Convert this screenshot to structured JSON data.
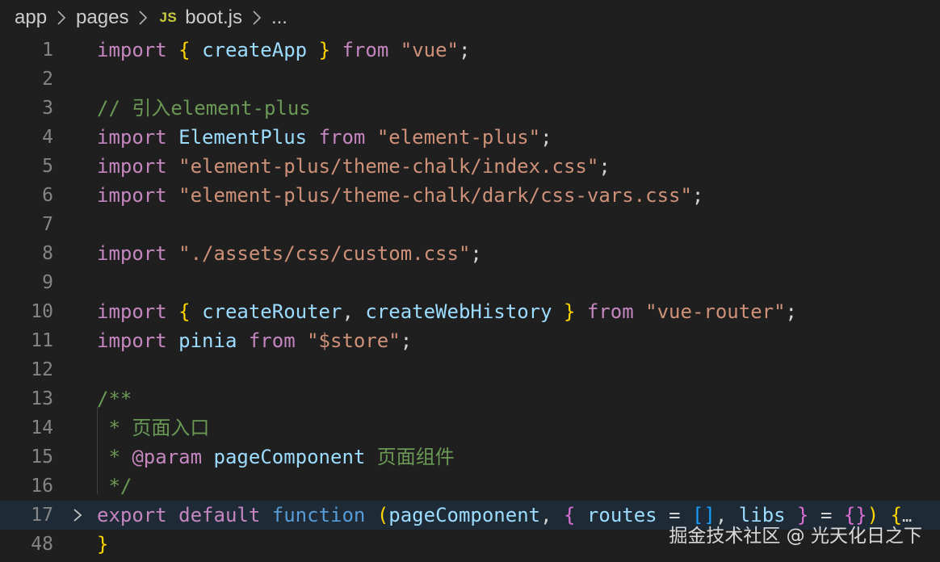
{
  "breadcrumb": {
    "items": [
      "app",
      "pages"
    ],
    "file_badge": "JS",
    "file_name": "boot.js",
    "overflow": "..."
  },
  "editor": {
    "lines": [
      {
        "num": "1",
        "tokens": [
          [
            "kw",
            "import"
          ],
          [
            "pun",
            " "
          ],
          [
            "br1",
            "{"
          ],
          [
            "pun",
            " "
          ],
          [
            "id",
            "createApp"
          ],
          [
            "pun",
            " "
          ],
          [
            "br1",
            "}"
          ],
          [
            "pun",
            " "
          ],
          [
            "kw",
            "from"
          ],
          [
            "pun",
            " "
          ],
          [
            "str",
            "\"vue\""
          ],
          [
            "pun",
            ";"
          ]
        ]
      },
      {
        "num": "2",
        "tokens": []
      },
      {
        "num": "3",
        "tokens": [
          [
            "com",
            "// 引入element-plus"
          ]
        ]
      },
      {
        "num": "4",
        "tokens": [
          [
            "kw",
            "import"
          ],
          [
            "pun",
            " "
          ],
          [
            "id",
            "ElementPlus"
          ],
          [
            "pun",
            " "
          ],
          [
            "kw",
            "from"
          ],
          [
            "pun",
            " "
          ],
          [
            "str",
            "\"element-plus\""
          ],
          [
            "pun",
            ";"
          ]
        ]
      },
      {
        "num": "5",
        "tokens": [
          [
            "kw",
            "import"
          ],
          [
            "pun",
            " "
          ],
          [
            "str",
            "\"element-plus/theme-chalk/index.css\""
          ],
          [
            "pun",
            ";"
          ]
        ]
      },
      {
        "num": "6",
        "tokens": [
          [
            "kw",
            "import"
          ],
          [
            "pun",
            " "
          ],
          [
            "str",
            "\"element-plus/theme-chalk/dark/css-vars.css\""
          ],
          [
            "pun",
            ";"
          ]
        ]
      },
      {
        "num": "7",
        "tokens": []
      },
      {
        "num": "8",
        "tokens": [
          [
            "kw",
            "import"
          ],
          [
            "pun",
            " "
          ],
          [
            "str",
            "\"./assets/css/custom.css\""
          ],
          [
            "pun",
            ";"
          ]
        ]
      },
      {
        "num": "9",
        "tokens": []
      },
      {
        "num": "10",
        "tokens": [
          [
            "kw",
            "import"
          ],
          [
            "pun",
            " "
          ],
          [
            "br1",
            "{"
          ],
          [
            "pun",
            " "
          ],
          [
            "id",
            "createRouter"
          ],
          [
            "pun",
            ", "
          ],
          [
            "id",
            "createWebHistory"
          ],
          [
            "pun",
            " "
          ],
          [
            "br1",
            "}"
          ],
          [
            "pun",
            " "
          ],
          [
            "kw",
            "from"
          ],
          [
            "pun",
            " "
          ],
          [
            "str",
            "\"vue-router\""
          ],
          [
            "pun",
            ";"
          ]
        ]
      },
      {
        "num": "11",
        "tokens": [
          [
            "kw",
            "import"
          ],
          [
            "pun",
            " "
          ],
          [
            "id",
            "pinia"
          ],
          [
            "pun",
            " "
          ],
          [
            "kw",
            "from"
          ],
          [
            "pun",
            " "
          ],
          [
            "str",
            "\"$store\""
          ],
          [
            "pun",
            ";"
          ]
        ]
      },
      {
        "num": "12",
        "tokens": []
      },
      {
        "num": "13",
        "tokens": [
          [
            "com",
            "/**"
          ]
        ]
      },
      {
        "num": "14",
        "tokens": [
          [
            "com",
            " * 页面入口"
          ]
        ]
      },
      {
        "num": "15",
        "tokens": [
          [
            "com",
            " * "
          ],
          [
            "tag",
            "@param"
          ],
          [
            "pun",
            " "
          ],
          [
            "id",
            "pageComponent"
          ],
          [
            "com",
            " 页面组件"
          ]
        ]
      },
      {
        "num": "16",
        "tokens": [
          [
            "com",
            " */"
          ]
        ]
      },
      {
        "num": "17",
        "tokens": [
          [
            "kw",
            "export"
          ],
          [
            "pun",
            " "
          ],
          [
            "kw",
            "default"
          ],
          [
            "pun",
            " "
          ],
          [
            "kwb",
            "function"
          ],
          [
            "pun",
            " "
          ],
          [
            "br1",
            "("
          ],
          [
            "id",
            "pageComponent"
          ],
          [
            "pun",
            ", "
          ],
          [
            "br2",
            "{"
          ],
          [
            "pun",
            " "
          ],
          [
            "id",
            "routes"
          ],
          [
            "pun",
            " = "
          ],
          [
            "br3",
            "[]"
          ],
          [
            "pun",
            ", "
          ],
          [
            "id",
            "libs"
          ],
          [
            "pun",
            " "
          ],
          [
            "br2",
            "}"
          ],
          [
            "pun",
            " = "
          ],
          [
            "br2",
            "{}"
          ],
          [
            "br1",
            ")"
          ],
          [
            "pun",
            " "
          ],
          [
            "br1",
            "{"
          ]
        ],
        "folded": true,
        "current": true
      },
      {
        "num": "48",
        "tokens": [
          [
            "br1",
            "}"
          ]
        ]
      }
    ],
    "fold_ellipsis": "…"
  },
  "watermark": "掘金技术社区 @ 光天化日之下"
}
